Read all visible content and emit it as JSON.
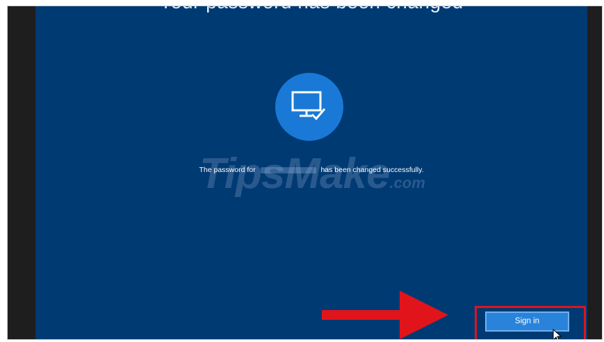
{
  "screen": {
    "top_title": "Your password has been changed",
    "message_before": "The password for",
    "message_after": "has been changed successfully.",
    "watermark_main": "TipsMake",
    "watermark_suffix": ".com",
    "background_color": "#003a73",
    "accent_color": "#1a79d6"
  },
  "actions": {
    "sign_in_label": "Sign in"
  },
  "annotations": {
    "highlight_color": "#e1141b",
    "arrow_color": "#e1141b"
  },
  "icons": {
    "avatar": "monitor-check-icon",
    "pointer": "mouse-pointer-icon",
    "arrow": "red-arrow-icon"
  }
}
